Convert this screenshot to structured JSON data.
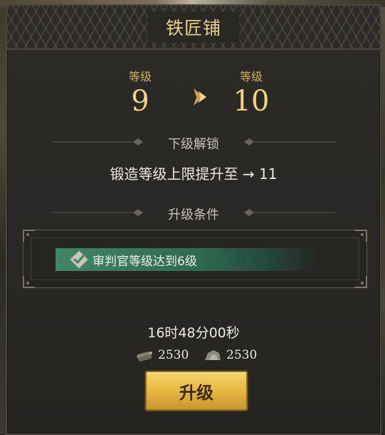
{
  "window": {
    "title": "铁匠铺"
  },
  "levels": {
    "current": {
      "label": "等级",
      "value": "9"
    },
    "next": {
      "label": "等级",
      "value": "10"
    }
  },
  "unlock": {
    "header": "下级解锁",
    "text": "锻造等级上限提升至 → 11"
  },
  "conditions": {
    "header": "升级条件",
    "items": [
      {
        "text": "审判官等级达到6级",
        "met": true
      }
    ]
  },
  "timer": "16时48分00秒",
  "costs": [
    {
      "icon": "wood-resource-icon",
      "value": "2530"
    },
    {
      "icon": "stone-resource-icon",
      "value": "2530"
    }
  ],
  "actions": {
    "upgrade_label": "升级"
  },
  "colors": {
    "gold": "#f0d57e",
    "accent_green": "#3f8666",
    "button": "#e7b83f"
  }
}
